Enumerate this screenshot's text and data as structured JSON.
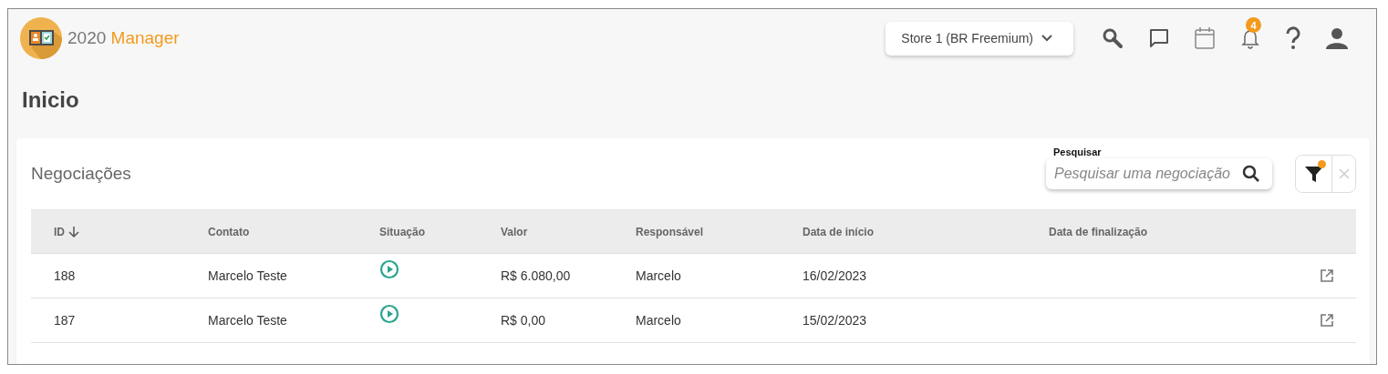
{
  "logo": {
    "number": "2020",
    "name": "Manager"
  },
  "header": {
    "store": "Store 1 (BR Freemium)",
    "notifications": "4"
  },
  "page_title": "Inicio",
  "card": {
    "title": "Negociações",
    "search": {
      "label": "Pesquisar",
      "placeholder": "Pesquisar uma negociação"
    },
    "filter": {
      "active": true
    },
    "clear": {
      "disabled": true
    },
    "table": {
      "columns": [
        {
          "label": "ID",
          "sorted": true
        },
        {
          "label": "Contato",
          "sorted": false
        },
        {
          "label": "Situação",
          "sorted": false
        },
        {
          "label": "Valor",
          "sorted": false
        },
        {
          "label": "Responsável",
          "sorted": false
        },
        {
          "label": "Data de início",
          "sorted": false
        },
        {
          "label": "Data de finalização",
          "sorted": false
        }
      ],
      "rows": [
        {
          "id": "188",
          "contact": "Marcelo Teste",
          "in_progress": true,
          "value": "R$ 6.080,00",
          "owner": "Marcelo",
          "start": "16/02/2023"
        },
        {
          "id": "187",
          "contact": "Marcelo Teste",
          "in_progress": true,
          "value": "R$ 0,00",
          "owner": "Marcelo",
          "start": "15/02/2023"
        }
      ]
    }
  }
}
